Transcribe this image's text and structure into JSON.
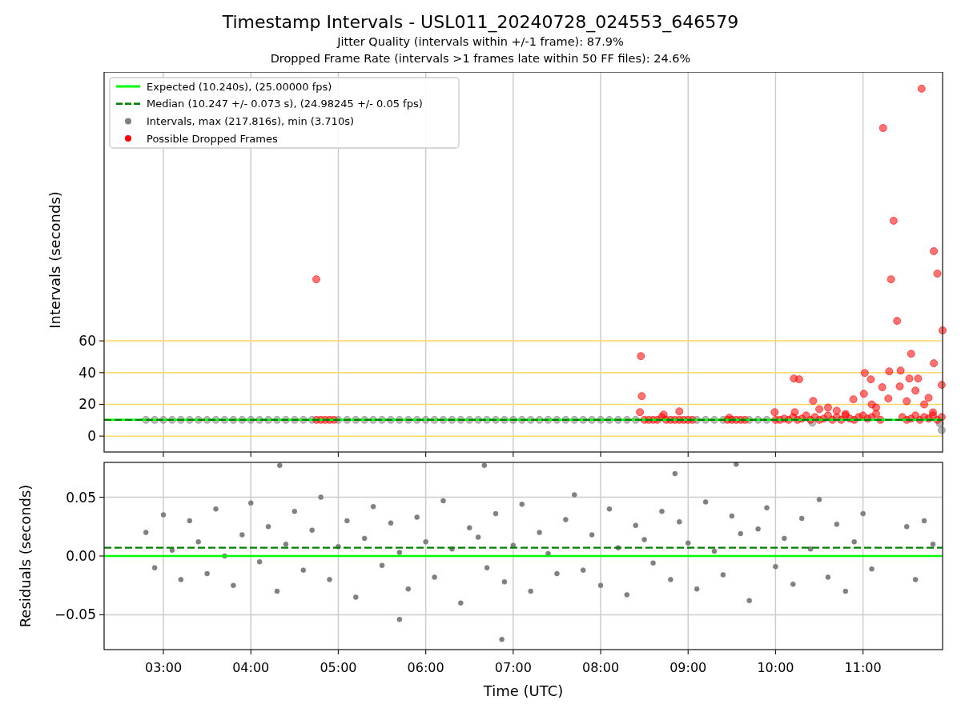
{
  "title": "Timestamp Intervals - USL011_20240728_024553_646579",
  "subtitles": [
    "Jitter Quality (intervals within +/-1 frame): 87.9%",
    "Dropped Frame Rate (intervals >1 frames late within 50 FF files): 24.6%"
  ],
  "intervals_plot": {
    "legend": [
      {
        "label": "Expected (10.240s), (25.00000 fps)",
        "kind": "line",
        "color": "#00ff00"
      },
      {
        "label": "Median (10.247 +/- 0.073 s), (24.98245 +/- 0.05 fps)",
        "kind": "dashed_line",
        "color": "#008000"
      },
      {
        "label": "Intervals, max (217.816s), min (3.710s)",
        "kind": "point",
        "color": "#808080"
      },
      {
        "label": "Possible Dropped Frames",
        "kind": "point",
        "color": "#ff0000"
      }
    ],
    "chart_data": {
      "type": "scatter",
      "grid": true,
      "ylabel": "Intervals (seconds)",
      "xlim": [
        2.322,
        11.91
      ],
      "ylim": [
        -10,
        229.4
      ],
      "yticks": [
        {
          "value": 0,
          "label": "0"
        },
        {
          "value": 20,
          "label": "20"
        },
        {
          "value": 40,
          "label": "40"
        },
        {
          "value": 60,
          "label": "60"
        }
      ],
      "series": [
        {
          "type": "line",
          "color": "#00ff00",
          "x": [
            2.322,
            11.91
          ],
          "values": [
            10.24,
            10.24
          ]
        },
        {
          "type": "line",
          "line_style": "dashed",
          "color": "#008000",
          "x": [
            2.322,
            11.91
          ],
          "values": [
            10.247,
            10.247
          ]
        },
        {
          "type": "scatter",
          "color": "#808080",
          "x": [
            2.8,
            2.9,
            3.0,
            3.1,
            3.2,
            3.3,
            3.4,
            3.5,
            3.6,
            3.7,
            3.8,
            3.9,
            4.0,
            4.1,
            4.2,
            4.3,
            4.4,
            4.5,
            4.6,
            4.7,
            5.0,
            5.1,
            5.2,
            5.3,
            5.4,
            5.5,
            5.6,
            5.7,
            5.8,
            5.9,
            6.0,
            6.1,
            6.2,
            6.3,
            6.4,
            6.5,
            6.6,
            6.7,
            6.8,
            6.9,
            7.0,
            7.1,
            7.2,
            7.3,
            7.4,
            7.5,
            7.6,
            7.7,
            7.8,
            7.9,
            8.0,
            8.1,
            8.2,
            8.3,
            8.4,
            9.1,
            9.2,
            9.3,
            9.4,
            9.7,
            9.8,
            9.9,
            10.42,
            11.88,
            11.9
          ],
          "values": [
            10.24,
            10.24,
            10.24,
            10.24,
            10.24,
            10.24,
            10.24,
            10.24,
            10.24,
            10.24,
            10.24,
            10.24,
            10.24,
            10.24,
            10.24,
            10.24,
            10.24,
            10.24,
            10.24,
            10.24,
            10.24,
            10.24,
            10.24,
            10.24,
            10.24,
            10.24,
            10.24,
            10.24,
            10.24,
            10.24,
            10.24,
            10.24,
            10.24,
            10.24,
            10.24,
            10.24,
            10.24,
            10.24,
            10.24,
            10.24,
            10.24,
            10.24,
            10.24,
            10.24,
            10.24,
            10.24,
            10.24,
            10.24,
            10.24,
            10.24,
            10.24,
            10.24,
            10.24,
            10.24,
            10.24,
            10.24,
            10.24,
            10.24,
            10.24,
            10.24,
            10.24,
            10.24,
            8.5,
            8.0,
            3.71
          ]
        },
        {
          "type": "scatter",
          "color": "#ff0000",
          "x": [
            4.75,
            4.8,
            4.85,
            4.9,
            4.95,
            8.5,
            8.55,
            8.6,
            8.65,
            8.7,
            8.75,
            8.8,
            8.85,
            8.9,
            8.95,
            9.0,
            9.05,
            9.45,
            9.5,
            9.55,
            9.6,
            9.65,
            10.0,
            10.05,
            10.1,
            10.15,
            10.2,
            10.25,
            10.3,
            10.35,
            10.4,
            10.45,
            10.5,
            10.55,
            10.6,
            10.65,
            10.7,
            10.75,
            10.8,
            10.85,
            10.9,
            10.95,
            11.0,
            11.05,
            11.1,
            11.15,
            11.2,
            11.45,
            11.5,
            11.55,
            11.6,
            11.65,
            11.7,
            11.75,
            11.8,
            11.85,
            11.9,
            4.749,
            11.67,
            11.23,
            11.35,
            11.81,
            11.32,
            11.85,
            11.39,
            11.91,
            8.46,
            8.47,
            11.55,
            11.02,
            11.3,
            11.43,
            11.81,
            11.9,
            10.21,
            10.27,
            11.09,
            11.53,
            11.63,
            11.42,
            11.22,
            11.01,
            11.6,
            10.43,
            10.89,
            11.29,
            8.9,
            9.99,
            10.22,
            8.45,
            8.72,
            9.47,
            11.75,
            10.6,
            10.7,
            10.5,
            11.1,
            11.15,
            11.5,
            11.7,
            11.8,
            10.8
          ],
          "values": [
            10.24,
            10.24,
            10.24,
            10.24,
            10.24,
            10.24,
            10.24,
            10.24,
            10.24,
            12,
            10.24,
            10.24,
            10.24,
            10.24,
            10.24,
            10.24,
            10.24,
            10.24,
            10.24,
            10.24,
            10.24,
            10.24,
            10.24,
            10.24,
            11,
            10.24,
            12,
            10.24,
            11,
            13,
            10.24,
            12,
            10.24,
            11,
            13,
            10.24,
            12,
            10.24,
            13,
            11,
            10.24,
            12,
            13,
            11,
            12,
            14,
            10.24,
            12,
            10.24,
            11,
            13,
            10.24,
            12,
            11,
            13,
            10.24,
            12,
            98.8,
            218.9,
            194.1,
            135.7,
            116.5,
            98.8,
            102.4,
            72.6,
            66.6,
            50.4,
            25.2,
            51.9,
            39.8,
            40.8,
            41.3,
            45.9,
            32.3,
            36.3,
            35.8,
            35.8,
            36.3,
            36.3,
            31.3,
            30.8,
            26.7,
            28.7,
            22.2,
            23.2,
            23.7,
            15.6,
            15.1,
            15.1,
            15.1,
            13.6,
            11.6,
            24.2,
            18,
            16,
            17,
            20,
            18,
            22,
            20,
            15,
            14
          ]
        }
      ]
    }
  },
  "residuals_plot": {
    "chart_data": {
      "type": "scatter",
      "grid": true,
      "xlabel": "Time (UTC)",
      "ylabel": "Residuals (seconds)",
      "xlim": [
        2.322,
        11.91
      ],
      "ylim": [
        -0.0796,
        0.0796
      ],
      "xticks": [
        {
          "value": 3,
          "label": "03:00"
        },
        {
          "value": 4,
          "label": "04:00"
        },
        {
          "value": 5,
          "label": "05:00"
        },
        {
          "value": 6,
          "label": "06:00"
        },
        {
          "value": 7,
          "label": "07:00"
        },
        {
          "value": 8,
          "label": "08:00"
        },
        {
          "value": 9,
          "label": "09:00"
        },
        {
          "value": 10,
          "label": "10:00"
        },
        {
          "value": 11,
          "label": "11:00"
        }
      ],
      "yticks": [
        {
          "value": 0.05,
          "label": "0.05"
        },
        {
          "value": 0,
          "label": "0.00"
        },
        {
          "value": -0.05,
          "label": "−0.05"
        }
      ],
      "series": [
        {
          "type": "line",
          "color": "#00ff00",
          "x": [
            2.322,
            11.91
          ],
          "values": [
            0,
            0
          ]
        },
        {
          "type": "line",
          "line_style": "dashed",
          "color": "#008000",
          "x": [
            2.322,
            11.91
          ],
          "values": [
            0.007,
            0.007
          ]
        },
        {
          "type": "scatter",
          "color": "#808080",
          "x": [
            2.8,
            2.9,
            3.0,
            3.1,
            3.2,
            3.3,
            3.4,
            3.5,
            3.6,
            3.7,
            3.8,
            3.9,
            4.0,
            4.1,
            4.2,
            4.3,
            4.4,
            4.5,
            4.6,
            4.7,
            4.8,
            4.9,
            5.0,
            5.1,
            5.2,
            5.3,
            5.4,
            5.5,
            5.6,
            5.7,
            5.8,
            5.9,
            6.0,
            6.1,
            6.2,
            6.3,
            6.4,
            6.5,
            6.6,
            6.7,
            6.8,
            6.9,
            7.0,
            7.1,
            7.2,
            7.3,
            7.4,
            7.5,
            7.6,
            7.7,
            7.8,
            7.9,
            8.0,
            8.1,
            8.2,
            8.3,
            8.4,
            8.5,
            8.6,
            8.7,
            8.8,
            8.9,
            9.0,
            9.1,
            9.2,
            9.3,
            9.4,
            9.5,
            9.6,
            9.7,
            9.8,
            9.9,
            10.0,
            10.1,
            10.2,
            10.3,
            10.4,
            10.5,
            10.6,
            10.7,
            10.8,
            10.9,
            11.0,
            11.1,
            11.5,
            11.6,
            11.7,
            11.8,
            4.33,
            6.67,
            9.55,
            8.85,
            6.87,
            5.7
          ],
          "values": [
            0.02,
            -0.01,
            0.035,
            0.005,
            -0.02,
            0.03,
            0.012,
            -0.015,
            0.04,
            0.0,
            -0.025,
            0.018,
            0.045,
            -0.005,
            0.025,
            -0.03,
            0.01,
            0.038,
            -0.012,
            0.022,
            0.05,
            -0.02,
            0.008,
            0.03,
            -0.035,
            0.015,
            0.042,
            -0.008,
            0.028,
            0.003,
            -0.028,
            0.033,
            0.012,
            -0.018,
            0.047,
            0.006,
            -0.04,
            0.024,
            0.016,
            -0.01,
            0.036,
            -0.022,
            0.009,
            0.044,
            -0.03,
            0.02,
            0.002,
            -0.015,
            0.031,
            0.052,
            -0.012,
            0.018,
            -0.025,
            0.04,
            0.007,
            -0.033,
            0.026,
            0.014,
            -0.006,
            0.038,
            -0.02,
            0.029,
            0.011,
            -0.028,
            0.046,
            0.004,
            -0.016,
            0.034,
            0.019,
            -0.038,
            0.023,
            0.041,
            -0.009,
            0.015,
            -0.024,
            0.032,
            0.006,
            0.048,
            -0.018,
            0.027,
            -0.03,
            0.012,
            0.036,
            -0.011,
            0.025,
            -0.02,
            0.03,
            0.01,
            0.077,
            0.077,
            0.078,
            0.07,
            -0.071,
            -0.054
          ]
        }
      ]
    }
  }
}
